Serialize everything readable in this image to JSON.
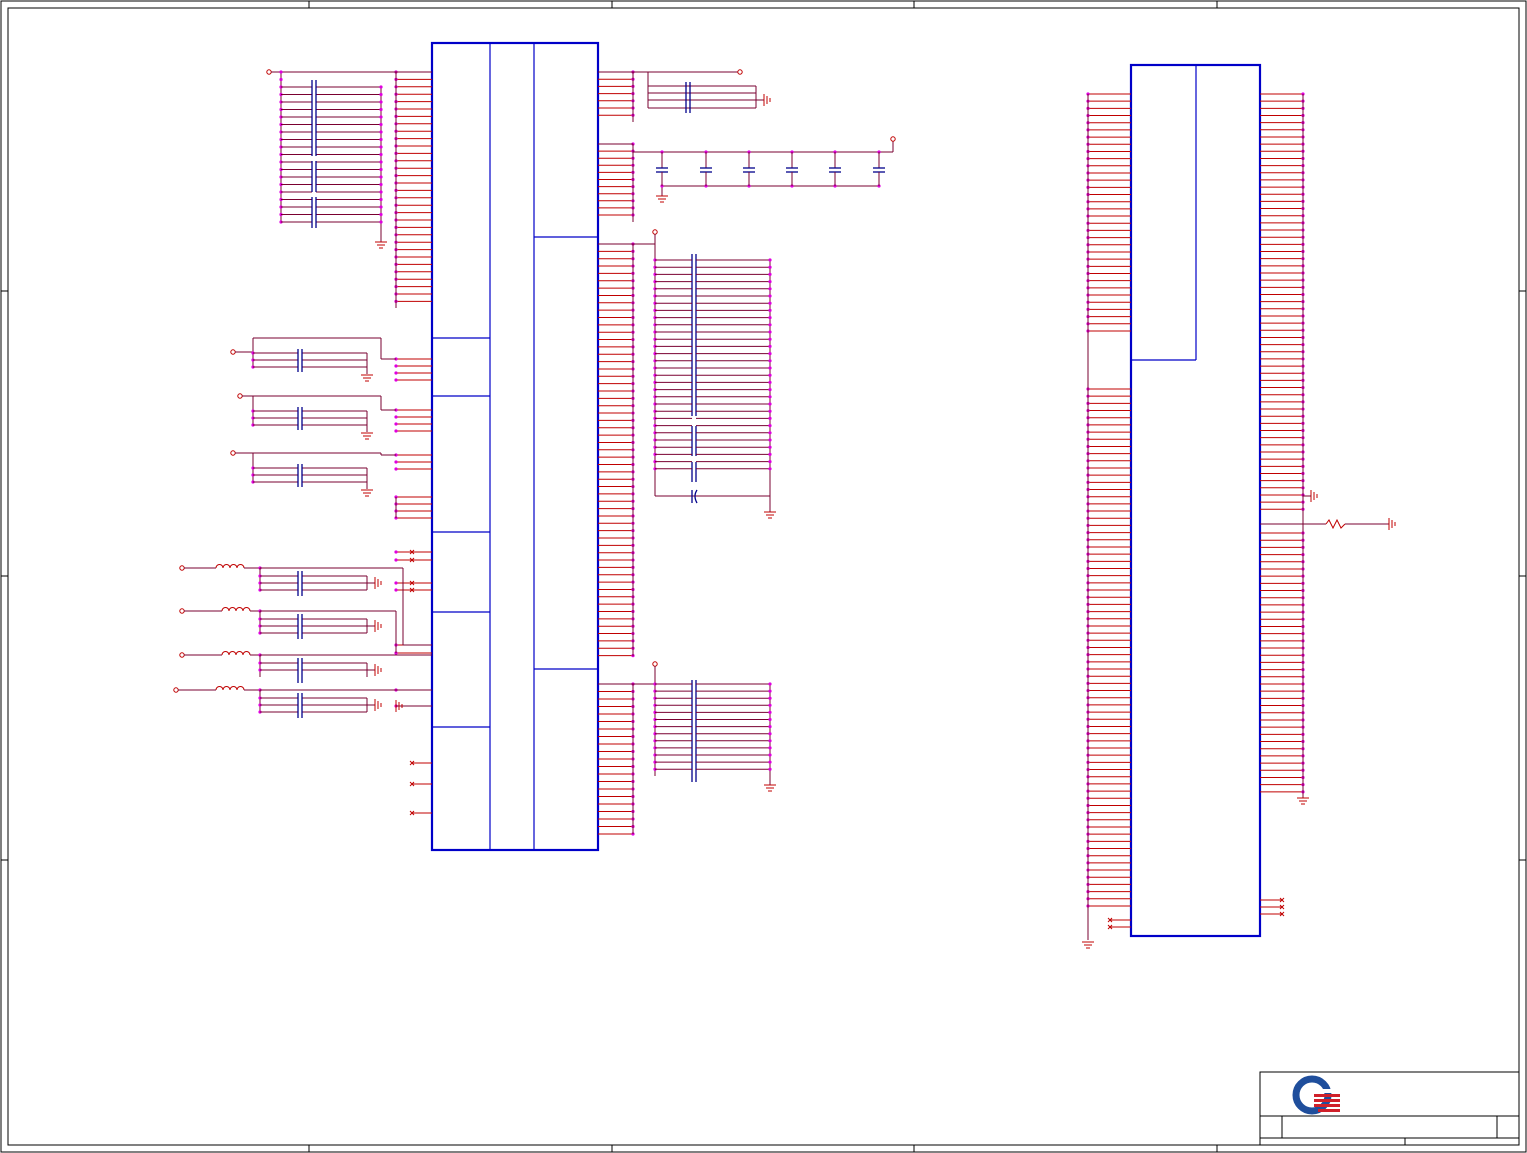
{
  "title_block": {
    "logo_icon": "q-logo-icon",
    "logo_colors": {
      "ring": "#1f4e9c",
      "stripes": "#d0202a"
    }
  },
  "colors": {
    "ic_outline": "#0000c8",
    "pin": "#c00000",
    "net": "#7a0030",
    "junction": "#e000e0",
    "capacitor": "#00008b"
  },
  "components": {
    "ic_left": "bga-chip-power-pins",
    "ic_right": "bga-chip-ground-pins"
  }
}
